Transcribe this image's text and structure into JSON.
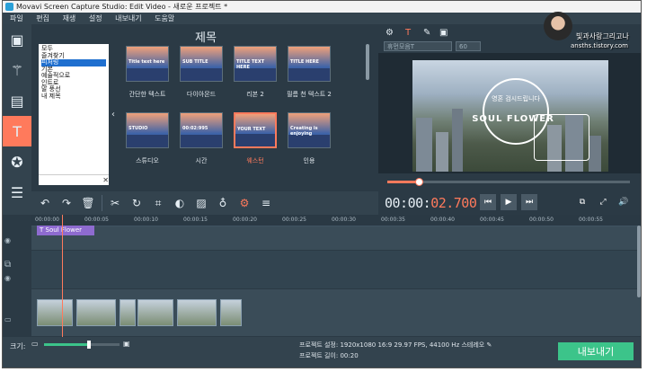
{
  "window": {
    "title": "Movavi Screen Capture Studio: Edit Video - 새로운 프로젝트 *"
  },
  "menu": [
    "파일",
    "편집",
    "재생",
    "설정",
    "내보내기",
    "도움말"
  ],
  "left_tools": [
    "film-icon",
    "magic-wand-icon",
    "filmstrip-icon",
    "text-icon",
    "star-icon",
    "list-icon"
  ],
  "titles_panel": {
    "heading": "제목",
    "categories": [
      "모두",
      "즐겨찾기",
      "피처링",
      "기본",
      "예술적으로",
      "인트로",
      "말 풍선",
      "내 제목"
    ],
    "selected_category": "피처링",
    "tiles": [
      {
        "label": "간단한 텍스트",
        "text": "Title text here"
      },
      {
        "label": "다이아몬드",
        "text": "SUB TITLE"
      },
      {
        "label": "리본 2",
        "text": "TITLE TEXT HERE"
      },
      {
        "label": "필름 천 텍스트 2",
        "text": "TITLE HERE"
      },
      {
        "label": "스튜디오",
        "text": "STUDIO"
      },
      {
        "label": "시간",
        "text": "00:02:995"
      },
      {
        "label": "웨스턴",
        "text": "YOUR TEXT"
      },
      {
        "label": "인용",
        "text": "Creating is enjoying"
      }
    ]
  },
  "text_props": {
    "font": "휴먼모음T",
    "size": "60"
  },
  "preview": {
    "main_text": "SOUL FLOWER",
    "arc_text": "영혼 검시드립니다",
    "progress_fraction": 0.13
  },
  "timecode": {
    "prefix": "00:00:",
    "current": "02.700"
  },
  "ruler_ticks": [
    "00:00:00",
    "00:00:05",
    "00:00:10",
    "00:00:15",
    "00:00:20",
    "00:00:25",
    "00:00:30",
    "00:00:35",
    "00:00:40",
    "00:00:45",
    "00:00:50",
    "00:00:55"
  ],
  "title_clip": "Soul Flower",
  "zoom": {
    "label": "크기:",
    "fraction": 0.6
  },
  "project": {
    "settings_label": "프로젝트 설정:",
    "settings_value": "1920x1080 16:9 29.97 FPS, 44100 Hz 스테레오",
    "length_label": "프로젝트 길이:",
    "length_value": "00:20"
  },
  "export_button": "내보내기",
  "watermark": {
    "line1": "빛과사랑그리고나",
    "line2": "ansths.tistory.com"
  }
}
